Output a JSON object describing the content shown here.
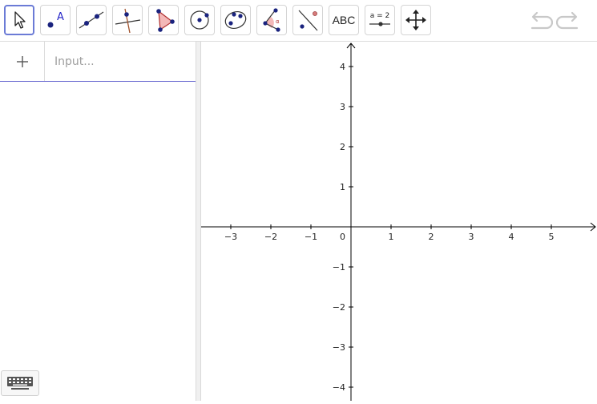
{
  "toolbar": {
    "tools": [
      {
        "id": "move",
        "icon": "cursor-arrow-icon",
        "selected": true
      },
      {
        "id": "point",
        "icon": "point-label-icon",
        "label": "A"
      },
      {
        "id": "line",
        "icon": "line-through-points-icon"
      },
      {
        "id": "perpendicular",
        "icon": "perpendicular-line-icon"
      },
      {
        "id": "polygon",
        "icon": "polygon-icon"
      },
      {
        "id": "circle",
        "icon": "circle-center-point-icon"
      },
      {
        "id": "conic",
        "icon": "ellipse-icon"
      },
      {
        "id": "angle",
        "icon": "angle-icon",
        "label": "α"
      },
      {
        "id": "reflect",
        "icon": "reflect-about-line-icon"
      },
      {
        "id": "text",
        "icon": "text-icon",
        "label": "ABC"
      },
      {
        "id": "slider",
        "icon": "slider-icon",
        "label": "a = 2"
      },
      {
        "id": "move-graphics",
        "icon": "move-graphics-view-icon"
      }
    ],
    "undo_icon": "undo-icon",
    "redo_icon": "redo-icon"
  },
  "algebra": {
    "add_icon": "plus-icon",
    "input_placeholder": "Input...",
    "keyboard_icon": "keyboard-icon"
  },
  "graphics": {
    "x_ticks": [
      "−3",
      "−2",
      "−1",
      "1",
      "2",
      "3",
      "4",
      "5"
    ],
    "x_values": [
      -3,
      -2,
      -1,
      1,
      2,
      3,
      4,
      5
    ],
    "y_ticks": [
      "4",
      "3",
      "2",
      "1",
      "−1",
      "−2",
      "−3",
      "−4"
    ],
    "y_values": [
      4,
      3,
      2,
      1,
      -1,
      -2,
      -3,
      -4
    ],
    "origin_label": "0",
    "axis_color": "#000000",
    "accent_color": "#6b7bd6"
  }
}
